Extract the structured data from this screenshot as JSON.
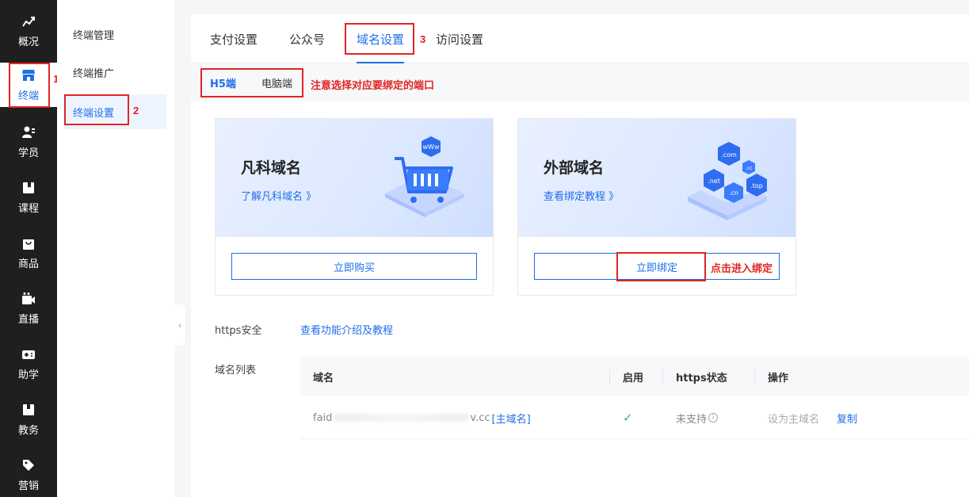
{
  "sidebar": {
    "items": [
      {
        "label": "概况",
        "icon": "overview-chart-icon"
      },
      {
        "label": "终端",
        "icon": "store-icon"
      },
      {
        "label": "学员",
        "icon": "students-icon"
      },
      {
        "label": "课程",
        "icon": "course-book-icon"
      },
      {
        "label": "商品",
        "icon": "shopping-bag-icon"
      },
      {
        "label": "直播",
        "icon": "live-camera-icon"
      },
      {
        "label": "助学",
        "icon": "gamepad-icon"
      },
      {
        "label": "教务",
        "icon": "academic-icon"
      },
      {
        "label": "营销",
        "icon": "tag-icon"
      }
    ],
    "active_index": 1
  },
  "submenu": {
    "items": [
      "终端管理",
      "终端推广",
      "终端设置"
    ],
    "active_index": 2
  },
  "tabs": {
    "items": [
      "支付设置",
      "公众号",
      "域名设置",
      "访问设置"
    ],
    "active_index": 2
  },
  "subtabs": {
    "items": [
      "H5端",
      "电脑端"
    ],
    "active_index": 0
  },
  "annotations": {
    "num1": "1",
    "num2": "2",
    "num3": "3",
    "subtab_note": "注意选择对应要绑定的端口",
    "bind_note": "点击进入绑定"
  },
  "cards": [
    {
      "title": "凡科域名",
      "link": "了解凡科域名 》",
      "button": "立即购买",
      "art": "shopping-cart"
    },
    {
      "title": "外部域名",
      "link": "查看绑定教程 》",
      "button": "立即绑定",
      "art": "domain-badges"
    }
  ],
  "art": {
    "www": "wWw",
    "com": ".com",
    "cc": ".cc",
    "net": ".net",
    "top": ".top",
    "cn": ".cn"
  },
  "https": {
    "label": "https安全",
    "link": "查看功能介绍及教程"
  },
  "domain_list": {
    "label": "域名列表",
    "columns": [
      "域名",
      "启用",
      "https状态",
      "操作"
    ],
    "rows": [
      {
        "domain_prefix": "faid",
        "domain_suffix": "v.cc",
        "primary_tag": "[主域名]",
        "enabled": "✓",
        "https_status": "未支持",
        "action_set_primary": "设为主域名",
        "action_copy": "复制"
      }
    ]
  },
  "colors": {
    "accent": "#1f6ee8",
    "annotation_red": "#e02424",
    "sidebar_bg": "#1f1f1f"
  }
}
